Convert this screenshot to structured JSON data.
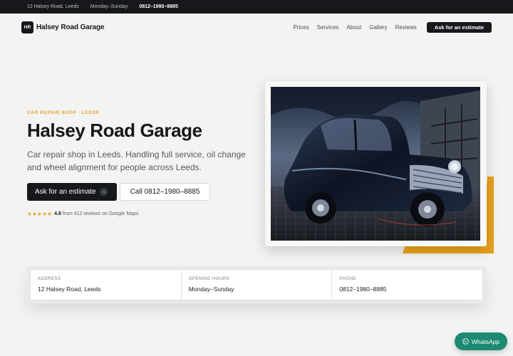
{
  "topbar": {
    "address": "12 Halsey Road, Leeds",
    "hours": "Monday–Sunday",
    "phone": "0812–1980–8885"
  },
  "nav": {
    "logo_initials": "HR",
    "brand": "Halsey Road Garage",
    "links": [
      "Prices",
      "Services",
      "About",
      "Gallery",
      "Reviews"
    ],
    "cta": "Ask for an estimate"
  },
  "hero": {
    "eyebrow": "CAR REPAIR SHOP · LEEDS",
    "title": "Halsey Road Garage",
    "subtitle": "Car repair shop in Leeds. Handling full service, oil change and wheel alignment for people across Leeds.",
    "primary_button": "Ask for an estimate",
    "primary_icon": "arrow-right-icon",
    "secondary_button": "Call 0812–1980–8885",
    "stars": "★★★★★",
    "rating_score": "4.8",
    "rating_text": "from 412 reviews on Google Maps"
  },
  "info": {
    "items": [
      {
        "label": "ADDRESS",
        "value": "12 Halsey Road, Leeds"
      },
      {
        "label": "OPENING HOURS",
        "value": "Monday–Sunday"
      },
      {
        "label": "PHONE",
        "value": "0812–1980–8885"
      }
    ]
  },
  "whatsapp": {
    "label": "WhatsApp",
    "icon": "whatsapp-icon"
  },
  "colors": {
    "accent": "#e9a21c",
    "dark": "#16181b",
    "whatsapp": "#1d8a73",
    "eyebrow": "#e0a52b"
  }
}
